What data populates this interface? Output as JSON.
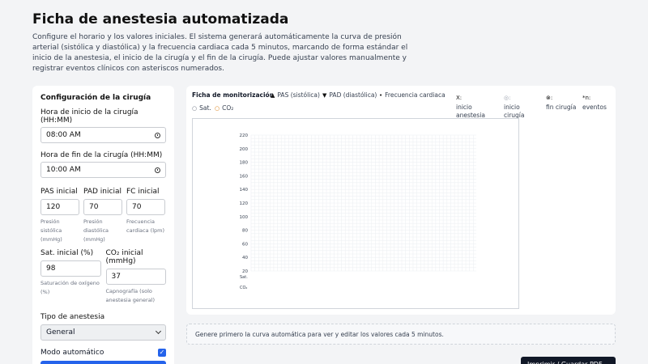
{
  "page": {
    "title": "Ficha de anestesia automatizada",
    "description": "Configure el horario y los valores iniciales. El sistema generará automáticamente la curva de presión arterial (sistólica y diastólica) y la frecuencia cardiaca cada 5 minutos, marcando de forma estándar el inicio de la anestesia, el inicio de la cirugía y el fin de la cirugía. Puede ajustar valores manualmente y registrar eventos clínicos con asteriscos numerados."
  },
  "config": {
    "heading": "Configuración de la cirugía",
    "start_label": "Hora de inicio de la cirugía (HH:MM)",
    "start_value": "08:00 AM",
    "end_label": "Hora de fin de la cirugía (HH:MM)",
    "end_value": "10:00 AM",
    "pas_label": "PAS inicial",
    "pas_value": "120",
    "pas_hint": "Presión sistólica (mmHg)",
    "pad_label": "PAD inicial",
    "pad_value": "70",
    "pad_hint": "Presión diastólica (mmHg)",
    "fc_label": "FC inicial",
    "fc_value": "70",
    "fc_hint": "Frecuencia cardiaca (lpm)",
    "sat_label": "Sat. inicial (%)",
    "sat_value": "98",
    "sat_hint": "Saturación de oxígeno (%)",
    "co2_label": "CO₂ inicial (mmHg)",
    "co2_value": "37",
    "co2_hint": "Capnografía (solo anestesia general)",
    "anesthesia_label": "Tipo de anestesia",
    "anesthesia_value": "General",
    "auto_label": "Modo automático",
    "auto_checked": true
  },
  "monitor": {
    "title": "Ficha de monitorización",
    "legend": [
      {
        "symbol": "▲",
        "label": "PAS (sistólica)"
      },
      {
        "symbol": "▼",
        "label": "PAD (diastólica)"
      },
      {
        "symbol": "•",
        "label": "Frecuencia cardiaca"
      },
      {
        "symbol": "X:",
        "label": "inicio anestesia"
      },
      {
        "symbol": "◎:",
        "label": "inicio cirugía"
      },
      {
        "symbol": "⊗:",
        "label": "fin cirugía"
      },
      {
        "symbol": "*n:",
        "label": "eventos"
      },
      {
        "symbol": "○",
        "label": "Sat."
      },
      {
        "symbol": "○",
        "label": "CO₂"
      }
    ]
  },
  "chart_data": {
    "type": "line",
    "title": "",
    "xlabel": "",
    "ylabel": "",
    "ylim": [
      20,
      220
    ],
    "y_ticks": [
      "220",
      "200",
      "180",
      "160",
      "140",
      "120",
      "100",
      "80",
      "60",
      "40",
      "20"
    ],
    "extra_rows": [
      "Sat.",
      "CO₂"
    ],
    "grid": true,
    "series": []
  },
  "message": "Genere primero la curva automática para ver y editar los valores cada 5 minutos.",
  "export_button": "Imprimir / Guardar PDF",
  "colors": {
    "accent": "#2563eb",
    "sat": "#6b7280",
    "co2": "#d97706"
  }
}
